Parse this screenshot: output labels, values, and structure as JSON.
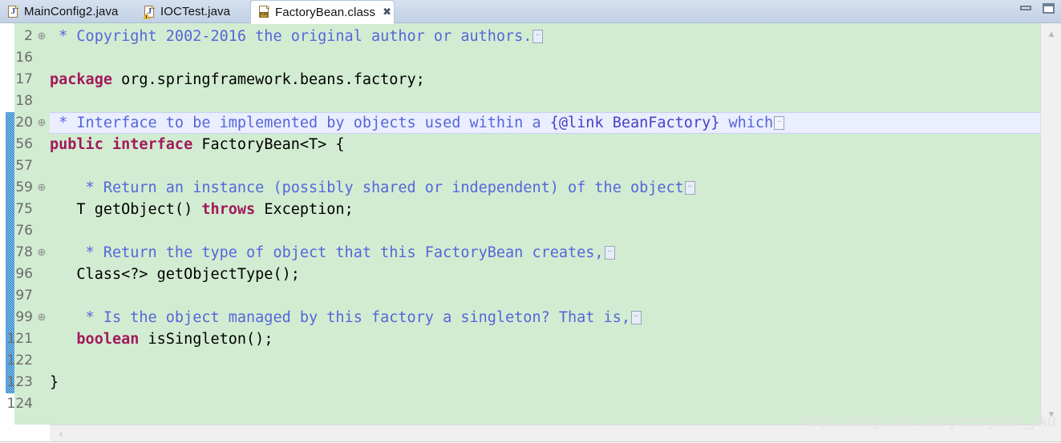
{
  "window": {
    "minimize_label": "Minimize",
    "maximize_label": "Maximize"
  },
  "tabs": [
    {
      "label": "MainConfig2.java",
      "icon": "java-file-icon",
      "active": false,
      "closable": false
    },
    {
      "label": "IOCTest.java",
      "icon": "java-file-warning-icon",
      "active": false,
      "closable": false
    },
    {
      "label": "FactoryBean.class",
      "icon": "class-file-icon",
      "active": true,
      "closable": true,
      "close_label": "✖"
    }
  ],
  "editor": {
    "background_color": "#d2ecd2",
    "current_line_color": "#eaeeff",
    "change_bar_color": "#1b78c8",
    "keyword_color": "#a2195b",
    "javadoc_color": "#5566d9",
    "lines": [
      {
        "num": "2",
        "fold": "⊕",
        "current": false,
        "tokens": [
          {
            "t": "doc",
            "v": " * Copyright 2002-2016 the original author or authors."
          },
          {
            "t": "foldbox",
            "v": ".."
          }
        ]
      },
      {
        "num": "16",
        "fold": "",
        "current": false,
        "tokens": []
      },
      {
        "num": "17",
        "fold": "",
        "current": false,
        "tokens": [
          {
            "t": "kw",
            "v": "package"
          },
          {
            "t": "blk",
            "v": " org.springframework.beans.factory;"
          }
        ]
      },
      {
        "num": "18",
        "fold": "",
        "current": false,
        "tokens": []
      },
      {
        "num": "20",
        "fold": "⊕",
        "current": true,
        "tokens": [
          {
            "t": "doc",
            "v": " * Interface to be implemented by objects used within a "
          },
          {
            "t": "doclink",
            "v": "{@link BeanFactory}"
          },
          {
            "t": "doc",
            "v": " which"
          },
          {
            "t": "foldbox",
            "v": ".."
          }
        ]
      },
      {
        "num": "56",
        "fold": "",
        "current": false,
        "tokens": [
          {
            "t": "kw",
            "v": "public interface"
          },
          {
            "t": "blk",
            "v": " FactoryBean<T> {"
          }
        ]
      },
      {
        "num": "57",
        "fold": "",
        "current": false,
        "tokens": []
      },
      {
        "num": "59",
        "fold": "⊕",
        "current": false,
        "tokens": [
          {
            "t": "doc",
            "v": "    * Return an instance (possibly shared or independent) of the object"
          },
          {
            "t": "foldbox",
            "v": ".."
          }
        ]
      },
      {
        "num": "75",
        "fold": "",
        "current": false,
        "tokens": [
          {
            "t": "blk",
            "v": "   T getObject() "
          },
          {
            "t": "kw",
            "v": "throws"
          },
          {
            "t": "blk",
            "v": " Exception;"
          }
        ]
      },
      {
        "num": "76",
        "fold": "",
        "current": false,
        "tokens": []
      },
      {
        "num": "78",
        "fold": "⊕",
        "current": false,
        "tokens": [
          {
            "t": "doc",
            "v": "    * Return the type of object that this FactoryBean creates,"
          },
          {
            "t": "foldbox",
            "v": ".."
          }
        ]
      },
      {
        "num": "96",
        "fold": "",
        "current": false,
        "tokens": [
          {
            "t": "blk",
            "v": "   Class<?> getObjectType();"
          }
        ]
      },
      {
        "num": "97",
        "fold": "",
        "current": false,
        "tokens": []
      },
      {
        "num": "99",
        "fold": "⊕",
        "current": false,
        "tokens": [
          {
            "t": "doc",
            "v": "    * Is the object managed by this factory a singleton? That is,"
          },
          {
            "t": "foldbox",
            "v": ".."
          }
        ]
      },
      {
        "num": "121",
        "fold": "",
        "current": false,
        "tokens": [
          {
            "t": "kw",
            "v": "   boolean"
          },
          {
            "t": "blk",
            "v": " isSingleton();"
          }
        ]
      },
      {
        "num": "122",
        "fold": "",
        "current": false,
        "tokens": []
      },
      {
        "num": "123",
        "fold": "",
        "current": false,
        "tokens": [
          {
            "t": "blk",
            "v": "}"
          }
        ]
      },
      {
        "num": "124",
        "fold": "",
        "current": false,
        "tokens": []
      }
    ],
    "change_bar": {
      "start_line_index": 4,
      "end_line_index": 16
    }
  },
  "scrollbars": {
    "vertical_up": "▴",
    "vertical_down": "▾",
    "horizontal_left": "‹"
  },
  "watermark": "https://blog.csdn.net/yerenyuan_pku"
}
